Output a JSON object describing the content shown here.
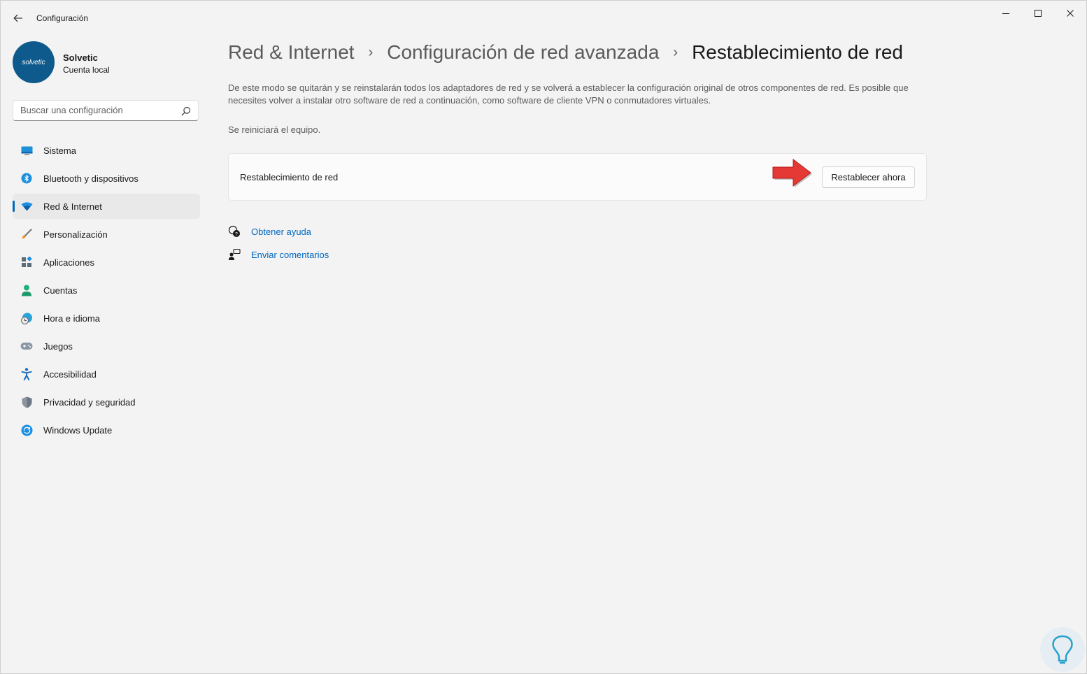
{
  "window": {
    "title": "Configuración"
  },
  "profile": {
    "avatar_text": "solvetic",
    "name": "Solvetic",
    "account_type": "Cuenta local"
  },
  "search": {
    "placeholder": "Buscar una configuración"
  },
  "sidebar": {
    "items": [
      {
        "label": "Sistema",
        "icon": "monitor-icon",
        "active": false
      },
      {
        "label": "Bluetooth y dispositivos",
        "icon": "bluetooth-icon",
        "active": false
      },
      {
        "label": "Red & Internet",
        "icon": "wifi-icon",
        "active": true
      },
      {
        "label": "Personalización",
        "icon": "paintbrush-icon",
        "active": false
      },
      {
        "label": "Aplicaciones",
        "icon": "apps-icon",
        "active": false
      },
      {
        "label": "Cuentas",
        "icon": "person-icon",
        "active": false
      },
      {
        "label": "Hora e idioma",
        "icon": "globe-clock-icon",
        "active": false
      },
      {
        "label": "Juegos",
        "icon": "gamepad-icon",
        "active": false
      },
      {
        "label": "Accesibilidad",
        "icon": "accessibility-icon",
        "active": false
      },
      {
        "label": "Privacidad y seguridad",
        "icon": "shield-icon",
        "active": false
      },
      {
        "label": "Windows Update",
        "icon": "sync-icon",
        "active": false
      }
    ]
  },
  "breadcrumb": {
    "level1": "Red & Internet",
    "level2": "Configuración de red avanzada",
    "current": "Restablecimiento de red"
  },
  "main": {
    "description": "De este modo se quitarán y se reinstalarán todos los adaptadores de red y se volverá a establecer la configuración original de otros componentes de red. Es posible que necesites volver a instalar otro software de red a continuación, como software de cliente VPN o conmutadores virtuales.",
    "restart_note": "Se reiniciará el equipo.",
    "card_label": "Restablecimiento de red",
    "reset_button": "Restablecer ahora"
  },
  "help": {
    "get_help": "Obtener ayuda",
    "send_feedback": "Enviar comentarios"
  },
  "colors": {
    "accent": "#0067c0",
    "annotation_arrow": "#e53935",
    "background": "#f3f3f3"
  }
}
